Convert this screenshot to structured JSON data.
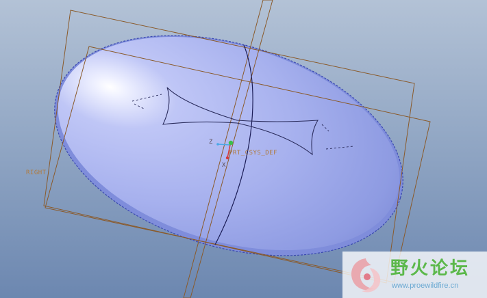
{
  "model_view": {
    "datum_planes": {
      "right_label": "RIGHT"
    },
    "coordinate_system": {
      "name": "PRT_CSYS_DEF",
      "axis_z": "Z",
      "axis_x": "X"
    }
  },
  "watermark": {
    "title": "野火论坛",
    "url": "www.proewildfire.cn"
  },
  "colors": {
    "datum_plane": "#8a5a2a",
    "surface": "#a4afef",
    "axis_x": "#d63a3a",
    "axis_y": "#3bbf4a",
    "axis_z": "#4aa8e6"
  }
}
